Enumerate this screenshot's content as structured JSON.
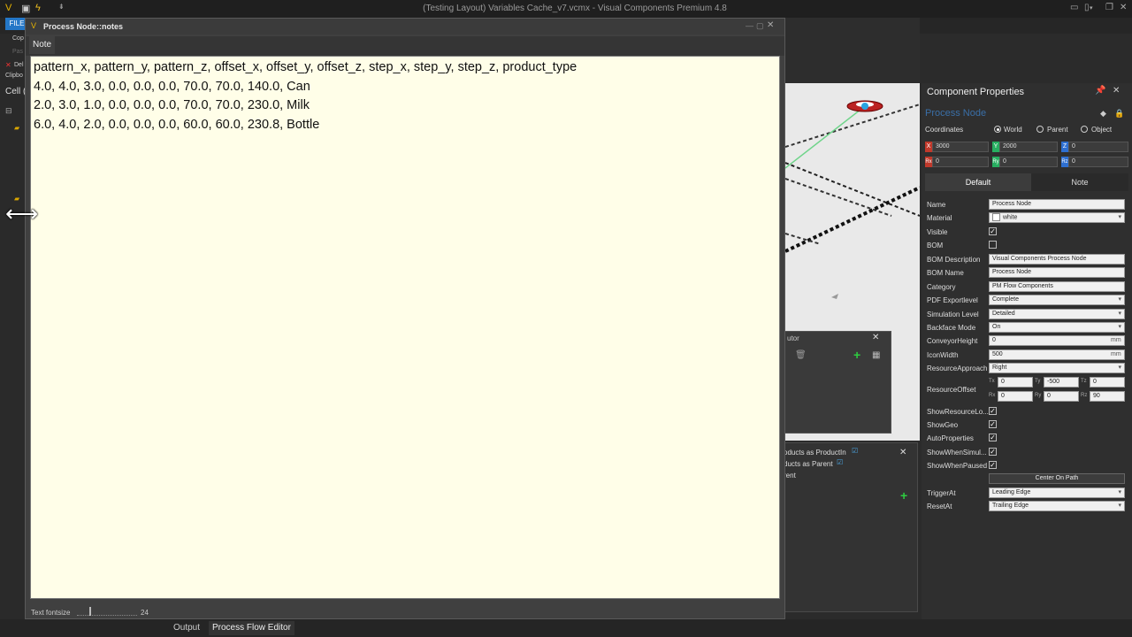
{
  "app": {
    "title": "(Testing Layout) Variables Cache_v7.vcmx - Visual Components Premium 4.8",
    "file_tab": "FILE"
  },
  "left_panel": {
    "items": [
      "Cop",
      "Pas",
      "Del",
      "Clipbo",
      "Cell ("
    ]
  },
  "note_window": {
    "title": "Process Node::notes",
    "tab": "Note",
    "lines": [
      "pattern_x, pattern_y, pattern_z, offset_x, offset_y, offset_z, step_x, step_y, step_z, product_type",
      "4.0, 4.0, 3.0, 0.0, 0.0, 0.0, 70.0, 70.0, 140.0, Can",
      "2.0, 3.0, 1.0, 0.0, 0.0, 0.0, 70.0, 70.0, 230.0, Milk",
      "6.0, 4.0, 2.0, 0.0, 0.0, 0.0, 60.0, 60.0, 230.8, Bottle"
    ],
    "font_label": "Text fontsize",
    "font_value": "24"
  },
  "flow_editor": {
    "title_fragment": "utor",
    "items": [
      "oducts as ProductIn",
      "ducts as Parent",
      "rent"
    ]
  },
  "bottom_tabs": [
    "Output",
    "Process Flow Editor"
  ],
  "properties": {
    "title": "Component Properties",
    "component_name": "Process Node",
    "coords_label": "Coordinates",
    "coord_options": [
      "World",
      "Parent",
      "Object"
    ],
    "x": "3000",
    "y": "2000",
    "z": "0",
    "rx": "0",
    "ry": "0",
    "rz": "0",
    "tabs": [
      "Default",
      "Note"
    ],
    "rows": [
      {
        "label": "Name",
        "value": "Process Node"
      },
      {
        "label": "Material",
        "value": "white"
      },
      {
        "label": "Visible",
        "checked": true
      },
      {
        "label": "BOM",
        "checked": false
      },
      {
        "label": "BOM Description",
        "value": "Visual Components Process Node"
      },
      {
        "label": "BOM Name",
        "value": "Process Node"
      },
      {
        "label": "Category",
        "value": "PM Flow Components"
      },
      {
        "label": "PDF Exportlevel",
        "value": "Complete"
      },
      {
        "label": "Simulation Level",
        "value": "Detailed"
      },
      {
        "label": "Backface Mode",
        "value": "On"
      },
      {
        "label": "ConveyorHeight",
        "value": "0",
        "unit": "mm"
      },
      {
        "label": "IconWidth",
        "value": "500",
        "unit": "mm"
      },
      {
        "label": "ResourceApproach",
        "value": "Right"
      }
    ],
    "resource_offset": {
      "label": "ResourceOffset",
      "tx": "0",
      "ty": "-500",
      "tz": "0",
      "rx": "0",
      "ry": "0",
      "rz": "90",
      "axes": [
        "Tx",
        "Ty",
        "Tz",
        "Rx",
        "Ry",
        "Rz"
      ]
    },
    "checks": [
      {
        "label": "ShowResourceLo...",
        "checked": true
      },
      {
        "label": "ShowGeo",
        "checked": true
      },
      {
        "label": "AutoProperties",
        "checked": true
      },
      {
        "label": "ShowWhenSimul...",
        "checked": true
      },
      {
        "label": "ShowWhenPaused",
        "checked": true
      }
    ],
    "center_button": "Center On Path",
    "trigger_label": "TriggerAt",
    "trigger_value": "Leading Edge",
    "reset_label": "ResetAt",
    "reset_value": "Trailing Edge",
    "axis_letters": [
      "X",
      "Y",
      "Z",
      "Rx",
      "Ry",
      "Rz"
    ]
  },
  "colors": {
    "accent": "#2477c7",
    "note_bg": "#fffee8",
    "x_axis": "#c0392b",
    "y_axis": "#27ae60",
    "z_axis": "#2e6fd1"
  }
}
